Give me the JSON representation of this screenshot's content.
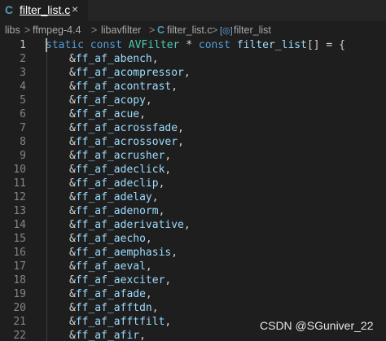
{
  "tab": {
    "icon_label": "C",
    "filename": "filter_list.c",
    "close_glyph": "×"
  },
  "breadcrumb": {
    "items": [
      "libs",
      "ffmpeg-4.4",
      "libavfilter",
      "filter_list.c",
      "filter_list"
    ],
    "separator": ">",
    "c_icon_label": "C",
    "symbol_icon_label": "[◎]"
  },
  "code": {
    "lines": [
      {
        "num": "1",
        "text": "static const AVFilter * const filter_list[] = {"
      },
      {
        "num": "2",
        "text": "&ff_af_abench,"
      },
      {
        "num": "3",
        "text": "&ff_af_acompressor,"
      },
      {
        "num": "4",
        "text": "&ff_af_acontrast,"
      },
      {
        "num": "5",
        "text": "&ff_af_acopy,"
      },
      {
        "num": "6",
        "text": "&ff_af_acue,"
      },
      {
        "num": "7",
        "text": "&ff_af_acrossfade,"
      },
      {
        "num": "8",
        "text": "&ff_af_acrossover,"
      },
      {
        "num": "9",
        "text": "&ff_af_acrusher,"
      },
      {
        "num": "10",
        "text": "&ff_af_adeclick,"
      },
      {
        "num": "11",
        "text": "&ff_af_adeclip,"
      },
      {
        "num": "12",
        "text": "&ff_af_adelay,"
      },
      {
        "num": "13",
        "text": "&ff_af_adenorm,"
      },
      {
        "num": "14",
        "text": "&ff_af_aderivative,"
      },
      {
        "num": "15",
        "text": "&ff_af_aecho,"
      },
      {
        "num": "16",
        "text": "&ff_af_aemphasis,"
      },
      {
        "num": "17",
        "text": "&ff_af_aeval,"
      },
      {
        "num": "18",
        "text": "&ff_af_aexciter,"
      },
      {
        "num": "19",
        "text": "&ff_af_afade,"
      },
      {
        "num": "20",
        "text": "&ff_af_afftdn,"
      },
      {
        "num": "21",
        "text": "&ff_af_afftfilt,"
      },
      {
        "num": "22",
        "text": "&ff_af_afir,"
      }
    ]
  },
  "watermark": "CSDN @SGuniver_22",
  "colors": {
    "background": "#1e1e1e",
    "keyword": "#569cd6",
    "type": "#4ec9b0",
    "variable": "#9cdcfe",
    "text": "#d4d4d4",
    "line_number": "#858585",
    "c_icon": "#519aba"
  }
}
